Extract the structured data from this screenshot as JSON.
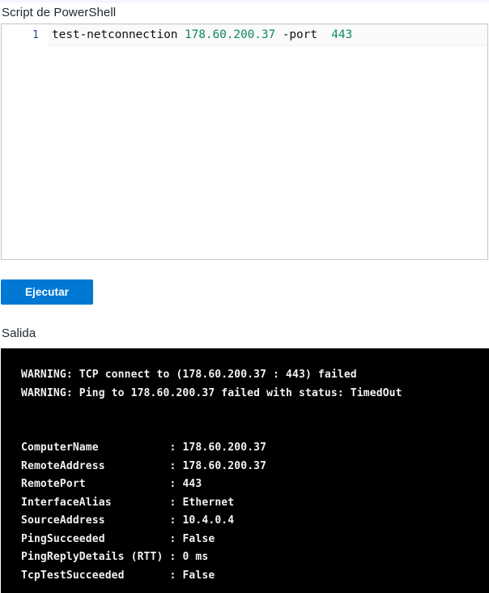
{
  "script_section": {
    "heading": "Script de PowerShell",
    "editor": {
      "line_number": "1",
      "tokens": {
        "command": "test-netconnection ",
        "host": "178.60.200.37",
        "space1": " ",
        "param": "-port",
        "space2": "  ",
        "port": "443"
      },
      "full_text": "test-netconnection 178.60.200.37 -port  443"
    }
  },
  "actions": {
    "run_label": "Ejecutar",
    "run_color": "#0078d4"
  },
  "output_section": {
    "heading": "Salida",
    "background": "#000000",
    "text_color": "#f2f2f2",
    "warnings": [
      "WARNING: TCP connect to (178.60.200.37 : 443) failed",
      "WARNING: Ping to 178.60.200.37 failed with status: TimedOut"
    ],
    "details": [
      {
        "label": "ComputerName",
        "sep": ":",
        "value": "178.60.200.37"
      },
      {
        "label": "RemoteAddress",
        "sep": ":",
        "value": "178.60.200.37"
      },
      {
        "label": "RemotePort",
        "sep": ":",
        "value": "443"
      },
      {
        "label": "InterfaceAlias",
        "sep": ":",
        "value": "Ethernet"
      },
      {
        "label": "SourceAddress",
        "sep": ":",
        "value": "10.4.0.4"
      },
      {
        "label": "PingSucceeded",
        "sep": ":",
        "value": "False"
      },
      {
        "label": "PingReplyDetails (RTT)",
        "sep": ":",
        "value": "0 ms"
      },
      {
        "label": "TcpTestSucceeded",
        "sep": ":",
        "value": "False"
      }
    ]
  }
}
